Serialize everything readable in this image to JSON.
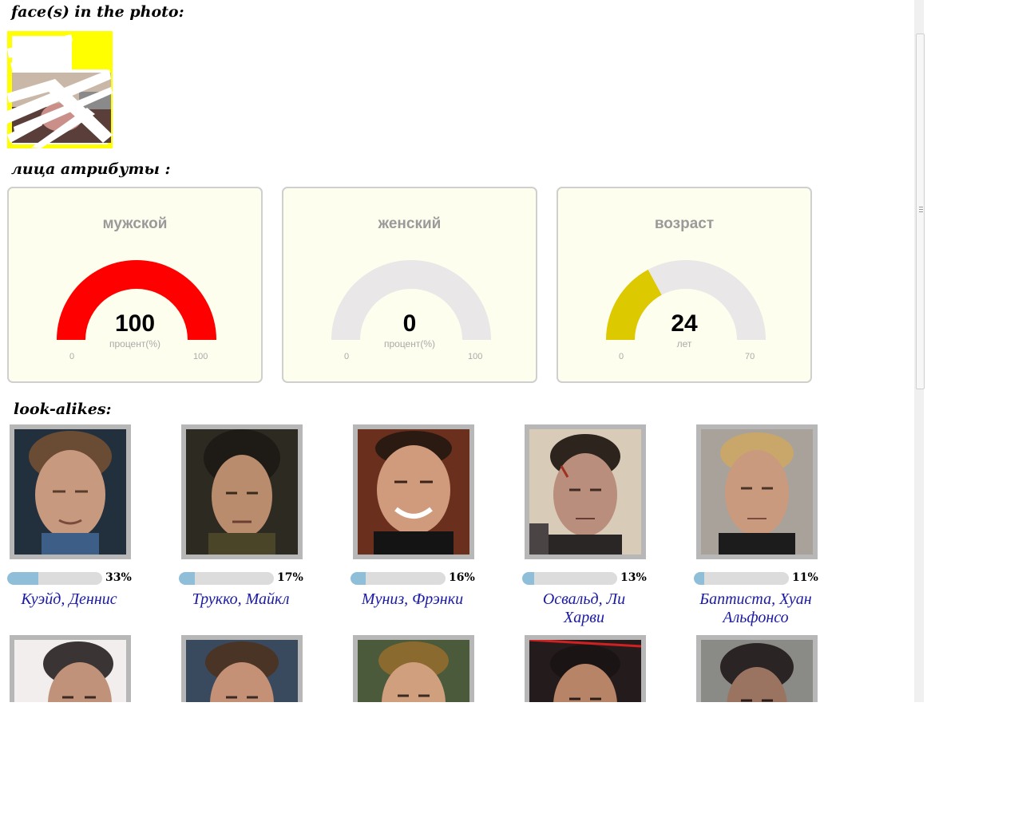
{
  "headings": {
    "faces": "face(s) in the photo:",
    "attributes": "лица атрибуты :",
    "lookalikes": "look-alikes:"
  },
  "colors": {
    "card_bg": "#fefeee",
    "male_gauge": "#ff0000",
    "age_gauge": "#ddc900",
    "gauge_track": "#e9e7e7",
    "similarity_bar": "#8fbfd8",
    "name_link": "#1a1aa6"
  },
  "gauges": [
    {
      "title": "мужской",
      "value": 100,
      "display": "100",
      "unit": "процент(%)",
      "min": "0",
      "max": "100",
      "max_value": 100,
      "color": "#ff0000"
    },
    {
      "title": "женский",
      "value": 0,
      "display": "0",
      "unit": "процент(%)",
      "min": "0",
      "max": "100",
      "max_value": 100,
      "color": "#e9e7e7"
    },
    {
      "title": "возраст",
      "value": 24,
      "display": "24",
      "unit": "лет",
      "min": "0",
      "max": "70",
      "max_value": 70,
      "color": "#ddc900"
    }
  ],
  "lookalikes": [
    {
      "name": "Куэйд, Деннис",
      "percent": "33%",
      "fraction": 0.33
    },
    {
      "name": "Трукко, Майкл",
      "percent": "17%",
      "fraction": 0.17
    },
    {
      "name": "Муниз, Фрэнки",
      "percent": "16%",
      "fraction": 0.16
    },
    {
      "name": "Освальд, Ли Харви",
      "percent": "13%",
      "fraction": 0.13
    },
    {
      "name": "Баптиста, Хуан Альфонсо",
      "percent": "11%",
      "fraction": 0.11
    }
  ]
}
